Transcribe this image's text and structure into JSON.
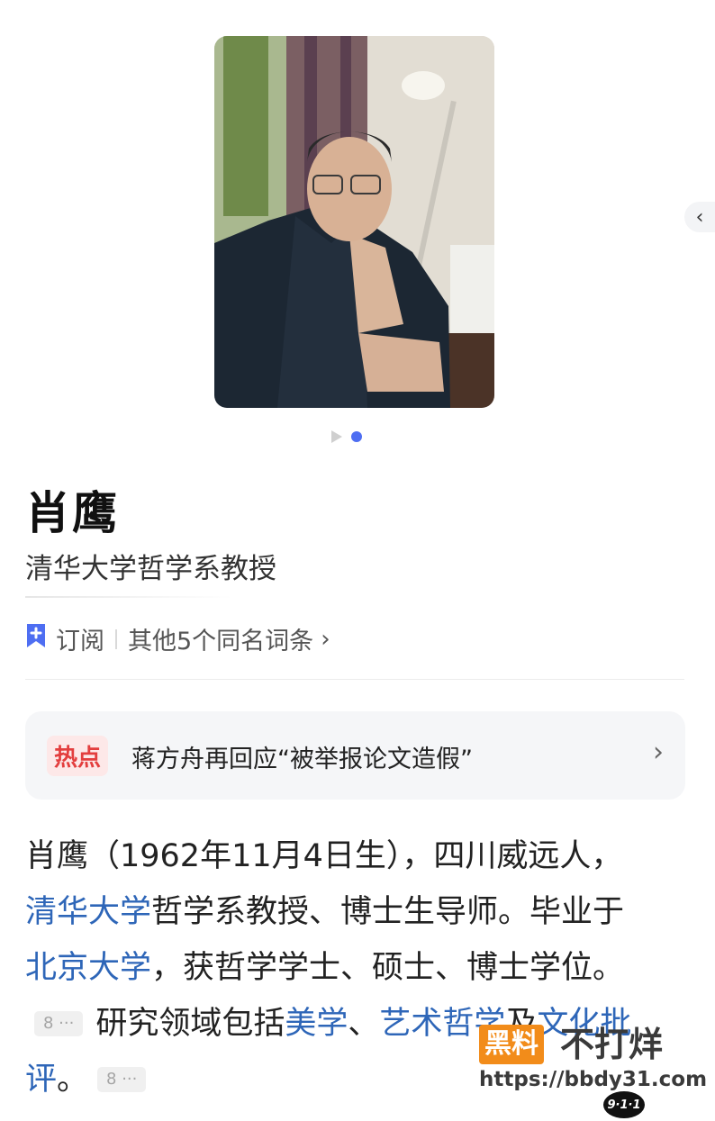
{
  "person": {
    "name": "肖鹰",
    "title": "清华大学哲学系教授"
  },
  "actions": {
    "subscribe_label": "订阅",
    "same_name_label": "其他5个同名词条"
  },
  "hot": {
    "badge": "热点",
    "text": "蒋方舟再回应“被举报论文造假”"
  },
  "summary": {
    "p1": "肖鹰（1962年11月4日生），四川威远人，",
    "link_tsinghua": "清华大学",
    "p2": "哲学系教授、博士生导师。毕业于",
    "link_pku": "北京大学",
    "p3": "，获哲学学士、硕士、博士学位。",
    "ref1": "8 ···",
    "p4": "研究领域包括",
    "link_aesthetics": "美学",
    "sep": "、",
    "link_art_philosophy": "艺术哲学",
    "and": "及",
    "link_cultural_criticism": "文化批评",
    "end": "。",
    "ref2": "8 ···"
  },
  "watermark": {
    "badge": "黑料",
    "text": "不打烊",
    "url": "https://bbdy31.com",
    "logo": "9·1·1"
  },
  "colors": {
    "link": "#2e66b8",
    "accent": "#4e6ef2",
    "hot_badge": "#e33e3e"
  }
}
